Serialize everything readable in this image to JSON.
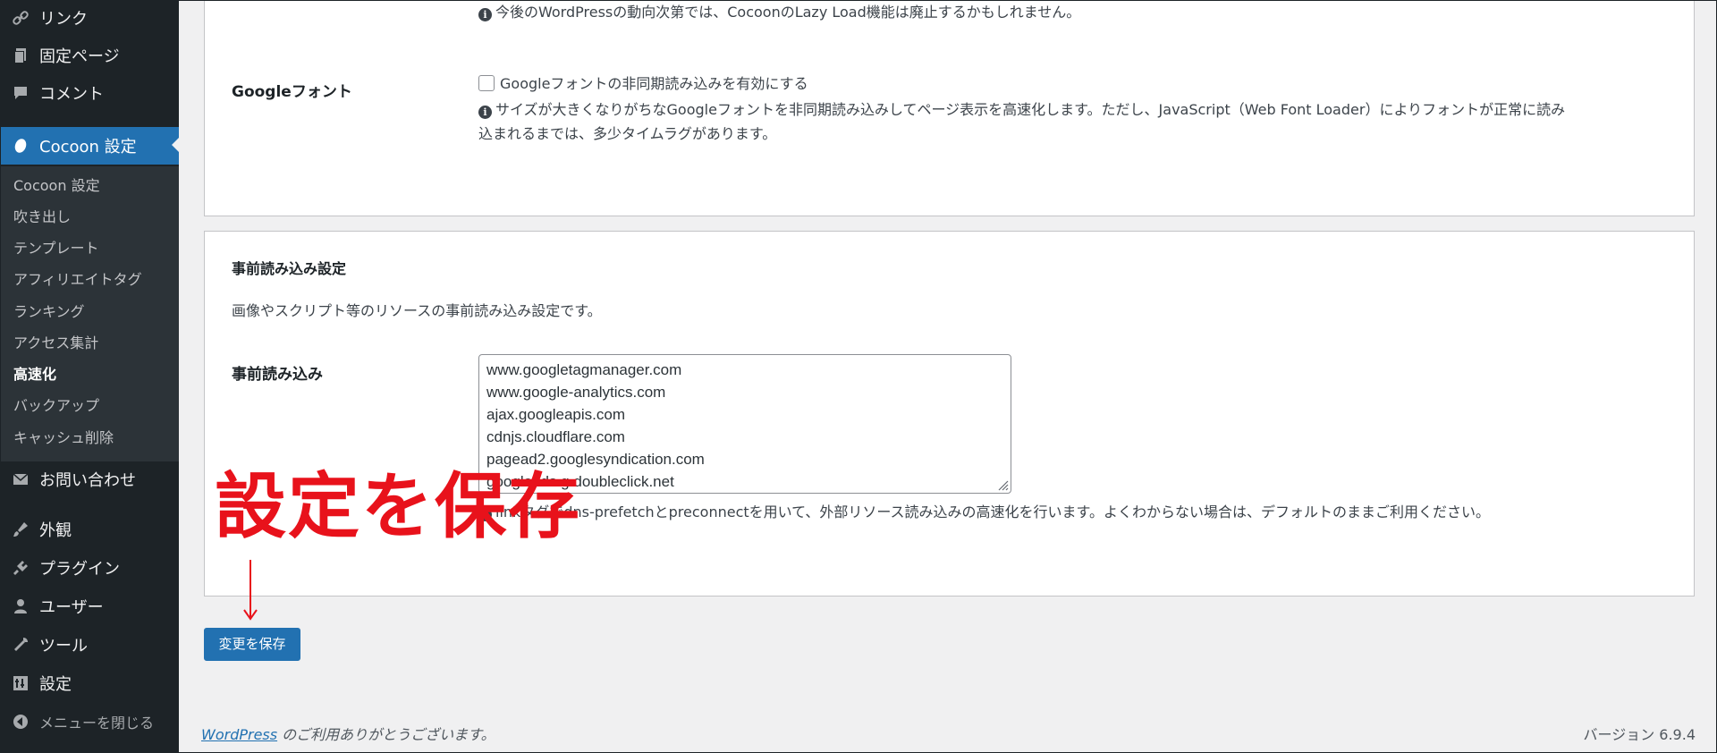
{
  "sidebar": {
    "items_top": [
      {
        "label": "リンク",
        "icon": "link-icon"
      },
      {
        "label": "固定ページ",
        "icon": "page-icon"
      },
      {
        "label": "コメント",
        "icon": "comment-icon"
      }
    ],
    "active": {
      "label": "Cocoon 設定",
      "icon": "cocoon-icon"
    },
    "submenu": [
      "Cocoon 設定",
      "吹き出し",
      "テンプレート",
      "アフィリエイトタグ",
      "ランキング",
      "アクセス集計",
      "高速化",
      "バックアップ",
      "キャッシュ削除"
    ],
    "current_submenu": "高速化",
    "items_bottom": [
      {
        "label": "お問い合わせ",
        "icon": "mail-icon"
      },
      {
        "label": "外観",
        "icon": "brush-icon"
      },
      {
        "label": "プラグイン",
        "icon": "plugin-icon"
      },
      {
        "label": "ユーザー",
        "icon": "user-icon"
      },
      {
        "label": "ツール",
        "icon": "wrench-icon"
      },
      {
        "label": "設定",
        "icon": "settings-icon"
      }
    ],
    "collapse": "メニューを閉じる"
  },
  "lazyload_note": "今後のWordPressの動向次第では、CocoonのLazy Load機能は廃止するかもしれません。",
  "google_fonts": {
    "label": "Googleフォント",
    "checkbox_label": "Googleフォントの非同期読み込みを有効にする",
    "checked": false,
    "desc_line1": "サイズが大きくなりがちなGoogleフォントを非同期読み込みしてページ表示を高速化します。ただし、JavaScript（Web Font Loader）によりフォントが正常に読み",
    "desc_line2": "込まれるまでは、多少タイムラグがあります。"
  },
  "preload": {
    "section_title": "事前読み込み設定",
    "section_desc": "画像やスクリプト等のリソースの事前読み込み設定です。",
    "label": "事前読み込み",
    "domains": [
      "www.googletagmanager.com",
      "www.google-analytics.com",
      "ajax.googleapis.com",
      "cdnjs.cloudflare.com",
      "pagead2.googlesyndication.com",
      "googleads.g.doubleclick.net"
    ],
    "desc_prefix": "linkタグで",
    "desc": "dns-prefetchとpreconnectを用いて、外部リソース読み込みの高速化を行います。よくわからない場合は、デフォルトのままご利用ください。"
  },
  "save_button": "変更を保存",
  "annotation": "設定を保存",
  "annotation_color": "#e8121b",
  "footer": {
    "link": "WordPress",
    "thanks": " のご利用ありがとうございます。",
    "version": "バージョン 6.9.4"
  },
  "colors": {
    "accent": "#2271b1",
    "sidebar_bg": "#1d2327",
    "submenu_bg": "#2c3338"
  }
}
